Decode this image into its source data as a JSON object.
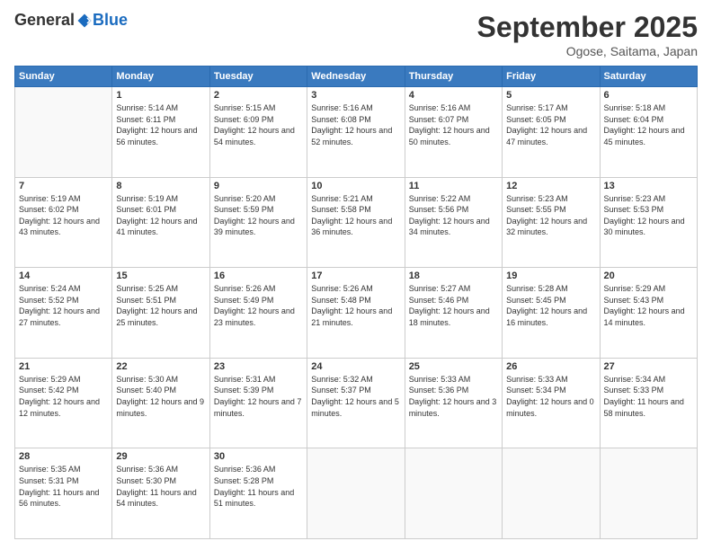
{
  "logo": {
    "general": "General",
    "blue": "Blue"
  },
  "header": {
    "month": "September 2025",
    "location": "Ogose, Saitama, Japan"
  },
  "weekdays": [
    "Sunday",
    "Monday",
    "Tuesday",
    "Wednesday",
    "Thursday",
    "Friday",
    "Saturday"
  ],
  "weeks": [
    [
      {
        "day": null
      },
      {
        "day": 1,
        "sunrise": "5:14 AM",
        "sunset": "6:11 PM",
        "daylight": "12 hours and 56 minutes."
      },
      {
        "day": 2,
        "sunrise": "5:15 AM",
        "sunset": "6:09 PM",
        "daylight": "12 hours and 54 minutes."
      },
      {
        "day": 3,
        "sunrise": "5:16 AM",
        "sunset": "6:08 PM",
        "daylight": "12 hours and 52 minutes."
      },
      {
        "day": 4,
        "sunrise": "5:16 AM",
        "sunset": "6:07 PM",
        "daylight": "12 hours and 50 minutes."
      },
      {
        "day": 5,
        "sunrise": "5:17 AM",
        "sunset": "6:05 PM",
        "daylight": "12 hours and 47 minutes."
      },
      {
        "day": 6,
        "sunrise": "5:18 AM",
        "sunset": "6:04 PM",
        "daylight": "12 hours and 45 minutes."
      }
    ],
    [
      {
        "day": 7,
        "sunrise": "5:19 AM",
        "sunset": "6:02 PM",
        "daylight": "12 hours and 43 minutes."
      },
      {
        "day": 8,
        "sunrise": "5:19 AM",
        "sunset": "6:01 PM",
        "daylight": "12 hours and 41 minutes."
      },
      {
        "day": 9,
        "sunrise": "5:20 AM",
        "sunset": "5:59 PM",
        "daylight": "12 hours and 39 minutes."
      },
      {
        "day": 10,
        "sunrise": "5:21 AM",
        "sunset": "5:58 PM",
        "daylight": "12 hours and 36 minutes."
      },
      {
        "day": 11,
        "sunrise": "5:22 AM",
        "sunset": "5:56 PM",
        "daylight": "12 hours and 34 minutes."
      },
      {
        "day": 12,
        "sunrise": "5:23 AM",
        "sunset": "5:55 PM",
        "daylight": "12 hours and 32 minutes."
      },
      {
        "day": 13,
        "sunrise": "5:23 AM",
        "sunset": "5:53 PM",
        "daylight": "12 hours and 30 minutes."
      }
    ],
    [
      {
        "day": 14,
        "sunrise": "5:24 AM",
        "sunset": "5:52 PM",
        "daylight": "12 hours and 27 minutes."
      },
      {
        "day": 15,
        "sunrise": "5:25 AM",
        "sunset": "5:51 PM",
        "daylight": "12 hours and 25 minutes."
      },
      {
        "day": 16,
        "sunrise": "5:26 AM",
        "sunset": "5:49 PM",
        "daylight": "12 hours and 23 minutes."
      },
      {
        "day": 17,
        "sunrise": "5:26 AM",
        "sunset": "5:48 PM",
        "daylight": "12 hours and 21 minutes."
      },
      {
        "day": 18,
        "sunrise": "5:27 AM",
        "sunset": "5:46 PM",
        "daylight": "12 hours and 18 minutes."
      },
      {
        "day": 19,
        "sunrise": "5:28 AM",
        "sunset": "5:45 PM",
        "daylight": "12 hours and 16 minutes."
      },
      {
        "day": 20,
        "sunrise": "5:29 AM",
        "sunset": "5:43 PM",
        "daylight": "12 hours and 14 minutes."
      }
    ],
    [
      {
        "day": 21,
        "sunrise": "5:29 AM",
        "sunset": "5:42 PM",
        "daylight": "12 hours and 12 minutes."
      },
      {
        "day": 22,
        "sunrise": "5:30 AM",
        "sunset": "5:40 PM",
        "daylight": "12 hours and 9 minutes."
      },
      {
        "day": 23,
        "sunrise": "5:31 AM",
        "sunset": "5:39 PM",
        "daylight": "12 hours and 7 minutes."
      },
      {
        "day": 24,
        "sunrise": "5:32 AM",
        "sunset": "5:37 PM",
        "daylight": "12 hours and 5 minutes."
      },
      {
        "day": 25,
        "sunrise": "5:33 AM",
        "sunset": "5:36 PM",
        "daylight": "12 hours and 3 minutes."
      },
      {
        "day": 26,
        "sunrise": "5:33 AM",
        "sunset": "5:34 PM",
        "daylight": "12 hours and 0 minutes."
      },
      {
        "day": 27,
        "sunrise": "5:34 AM",
        "sunset": "5:33 PM",
        "daylight": "11 hours and 58 minutes."
      }
    ],
    [
      {
        "day": 28,
        "sunrise": "5:35 AM",
        "sunset": "5:31 PM",
        "daylight": "11 hours and 56 minutes."
      },
      {
        "day": 29,
        "sunrise": "5:36 AM",
        "sunset": "5:30 PM",
        "daylight": "11 hours and 54 minutes."
      },
      {
        "day": 30,
        "sunrise": "5:36 AM",
        "sunset": "5:28 PM",
        "daylight": "11 hours and 51 minutes."
      },
      {
        "day": null
      },
      {
        "day": null
      },
      {
        "day": null
      },
      {
        "day": null
      }
    ]
  ]
}
